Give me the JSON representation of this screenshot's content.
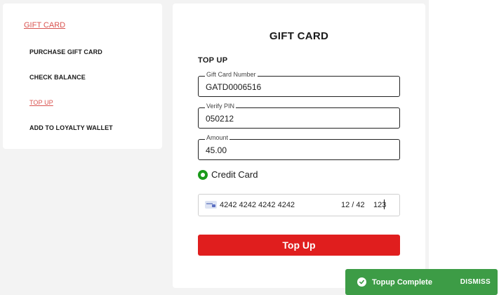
{
  "sidebar": {
    "title": "GIFT CARD",
    "items": [
      {
        "label": "PURCHASE GIFT CARD",
        "active": false
      },
      {
        "label": "CHECK BALANCE",
        "active": false
      },
      {
        "label": "TOP UP",
        "active": true
      },
      {
        "label": "ADD TO LOYALTY WALLET",
        "active": false
      }
    ]
  },
  "main": {
    "title": "GIFT CARD",
    "section": "TOP UP",
    "fields": {
      "card_number": {
        "label": "Gift Card Number",
        "value": "GATD0006516"
      },
      "pin": {
        "label": "Verify PIN",
        "value": "050212"
      },
      "amount": {
        "label": "Amount",
        "value": "45.00"
      }
    },
    "payment_method": {
      "label": "Credit Card",
      "selected": true
    },
    "card_input": {
      "number": "4242 4242 4242 4242",
      "expiry": "12 / 42",
      "cvc": "123"
    },
    "submit_label": "Top Up"
  },
  "toast": {
    "message": "Topup Complete",
    "dismiss_label": "DISMISS",
    "icon": "check-circle-icon"
  },
  "colors": {
    "accent_red": "#e01e1e",
    "link_red": "#d9534f",
    "success_green": "#3d9c46",
    "radio_green": "#1a9a1a"
  }
}
